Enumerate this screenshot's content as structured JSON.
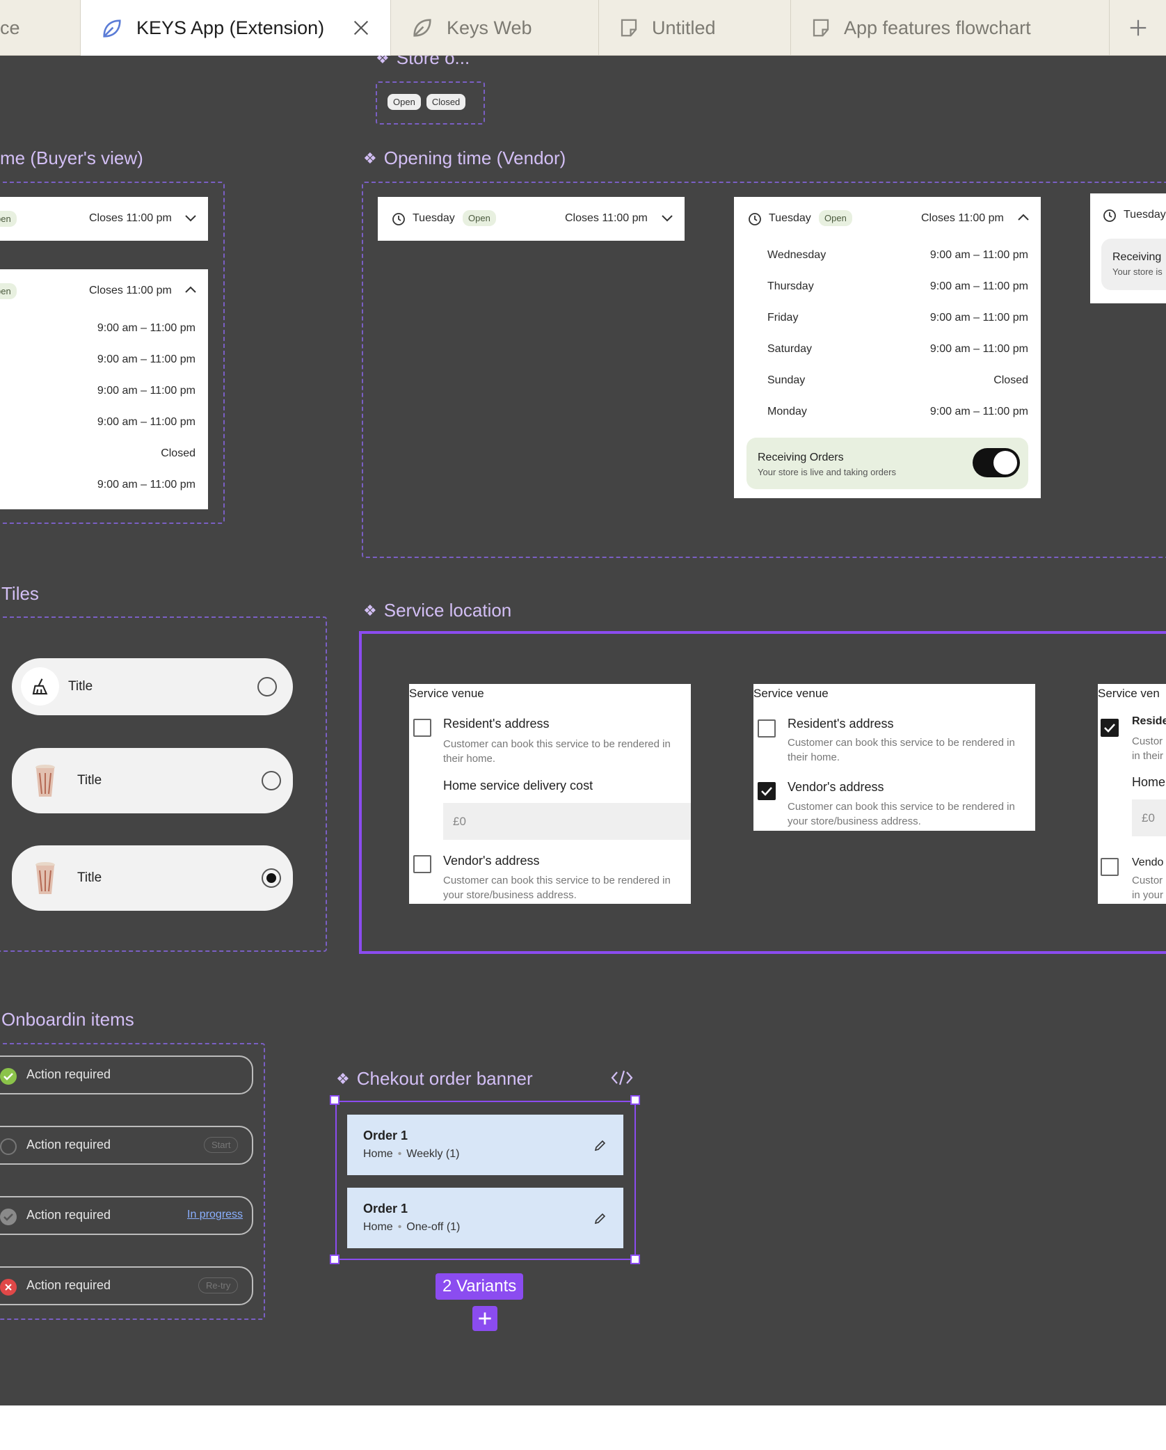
{
  "tabs": [
    {
      "label": "ce"
    },
    {
      "label": "KEYS App (Extension)"
    },
    {
      "label": "Keys Web"
    },
    {
      "label": "Untitled"
    },
    {
      "label": "App features flowchart"
    }
  ],
  "store_open": {
    "title": "Store o...",
    "open": "Open",
    "closed": "Closed"
  },
  "buyer_view": {
    "title": "me (Buyer's view)",
    "collapsed": {
      "status": "pen",
      "closes": "Closes 11:00 pm"
    },
    "expanded": {
      "status": "pen",
      "closes": "Closes 11:00 pm",
      "times": [
        "9:00 am – 11:00 pm",
        "9:00 am – 11:00 pm",
        "9:00 am – 11:00 pm",
        "9:00 am – 11:00 pm",
        "Closed",
        "9:00 am – 11:00 pm"
      ]
    }
  },
  "vendor_view": {
    "title": "Opening time (Vendor)",
    "collapsed": {
      "day": "Tuesday",
      "status": "Open",
      "closes": "Closes 11:00 pm"
    },
    "expanded": {
      "day": "Tuesday",
      "status": "Open",
      "closes": "Closes 11:00 pm",
      "rows": [
        {
          "day": "Wednesday",
          "time": "9:00 am – 11:00 pm"
        },
        {
          "day": "Thursday",
          "time": "9:00 am – 11:00 pm"
        },
        {
          "day": "Friday",
          "time": "9:00 am – 11:00 pm"
        },
        {
          "day": "Saturday",
          "time": "9:00 am – 11:00 pm"
        },
        {
          "day": "Sunday",
          "time": "Closed"
        },
        {
          "day": "Monday",
          "time": "9:00 am – 11:00 pm"
        }
      ],
      "receiving_title": "Receiving Orders",
      "receiving_sub": "Your store is live and taking orders"
    },
    "partial": {
      "day": "Tuesday",
      "receiving": "Receiving",
      "sub": "Your store is"
    }
  },
  "tiles": {
    "title": "Tiles",
    "items": [
      {
        "label": "Title"
      },
      {
        "label": "Title"
      },
      {
        "label": "Title"
      }
    ]
  },
  "service_location": {
    "title": "Service location",
    "venue_label": "Service venue",
    "resident": "Resident's address",
    "resident_sub": "Customer can book this service to be rendered in their home.",
    "delivery_cost_label": "Home service delivery cost",
    "cost_placeholder": "£0",
    "vendor": "Vendor's address",
    "vendor_sub": "Customer can book this service to be rendered in your store/business address.",
    "partial": {
      "venue": "Service ven",
      "resident": "Reside",
      "sub1": "Custor",
      "sub2": "in their",
      "home": "Home",
      "cost": "£0",
      "vendor": "Vendo",
      "vsub1": "Custor",
      "vsub2": "in your"
    }
  },
  "onboarding": {
    "title": "Onboardin items",
    "items": [
      {
        "label": "Action required",
        "tag": ""
      },
      {
        "label": "Action required",
        "tag": "Start"
      },
      {
        "label": "Action required",
        "tag": "In progress"
      },
      {
        "label": "Action required",
        "tag": "Re-try"
      }
    ]
  },
  "checkout": {
    "title": "Chekout order banner",
    "orders": [
      {
        "title": "Order 1",
        "place": "Home",
        "freq": "Weekly (1)"
      },
      {
        "title": "Order 1",
        "place": "Home",
        "freq": "One-off (1)"
      }
    ],
    "variants": "2 Variants"
  },
  "colors": {
    "canvas": "#444444",
    "accent": "#8b4cf0",
    "section_title": "#d3bff5",
    "order_bg": "#d8e6f7"
  }
}
